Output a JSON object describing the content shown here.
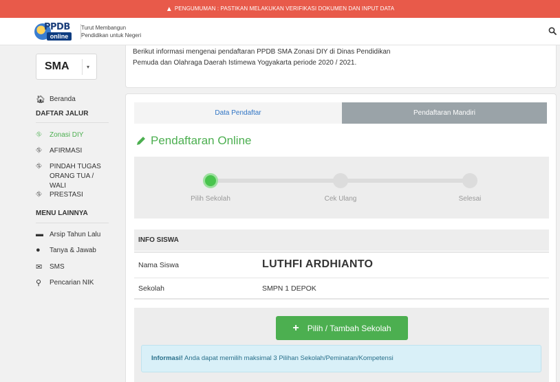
{
  "announcement": {
    "text": "PENGUMUMAN : PASTIKAN MELAKUKAN VERIFIKASI DOKUMEN DAN INPUT DATA"
  },
  "header": {
    "logo_top": "PPDB",
    "logo_bottom": "online",
    "tagline_1": "Turut Membangun",
    "tagline_2": "Pendidikan untuk Negeri"
  },
  "sidebar": {
    "level": "SMA",
    "home": "Beranda",
    "daftar_jalur_title": "DAFTAR JALUR",
    "jalur": [
      {
        "label": "Zonasi DIY",
        "icon": "road-icon",
        "active": true
      },
      {
        "label": "AFIRMASI",
        "icon": "road-icon"
      },
      {
        "label": "PINDAH TUGAS ORANG TUA / WALI",
        "icon": "road-icon"
      },
      {
        "label": "PRESTASI",
        "icon": "road-icon"
      }
    ],
    "menu_lainnya_title": "MENU LAINNYA",
    "lainnya": [
      {
        "label": "Arsip Tahun Lalu",
        "icon": "archive-icon"
      },
      {
        "label": "Tanya & Jawab",
        "icon": "chat-icon"
      },
      {
        "label": "SMS",
        "icon": "envelope-icon"
      },
      {
        "label": "Pencarian NIK",
        "icon": "search-icon"
      }
    ]
  },
  "intro": {
    "text": "Berikut informasi mengenai pendaftaran PPDB SMA Zonasi DIY di Dinas Pendidikan Pemuda dan Olahraga Daerah Istimewa Yogyakarta periode 2020 / 2021."
  },
  "tabs": {
    "data_pendaftar": "Data Pendaftar",
    "pendaftaran_mandiri": "Pendaftaran Mandiri"
  },
  "section_title": "Pendaftaran Online",
  "steps": [
    "Pilih Sekolah",
    "Cek Ulang",
    "Selesai"
  ],
  "current_step": 1,
  "info_siswa": {
    "title": "INFO SISWA",
    "nama_label": "Nama Siswa",
    "nama_value": "LUTHFI ARDHIANTO",
    "sekolah_label": "Sekolah",
    "sekolah_value": "SMPN 1 DEPOK"
  },
  "action": {
    "button_label": "Pilih / Tambah Sekolah",
    "alert_strong": "Informasi!",
    "alert_text": " Anda dapat memilih maksimal 3 Pilihan Sekolah/Peminatan/Kompetensi"
  },
  "colors": {
    "accent_green": "#4caf50",
    "announcement_red": "#e85a4a",
    "link_blue": "#2f74c4"
  }
}
